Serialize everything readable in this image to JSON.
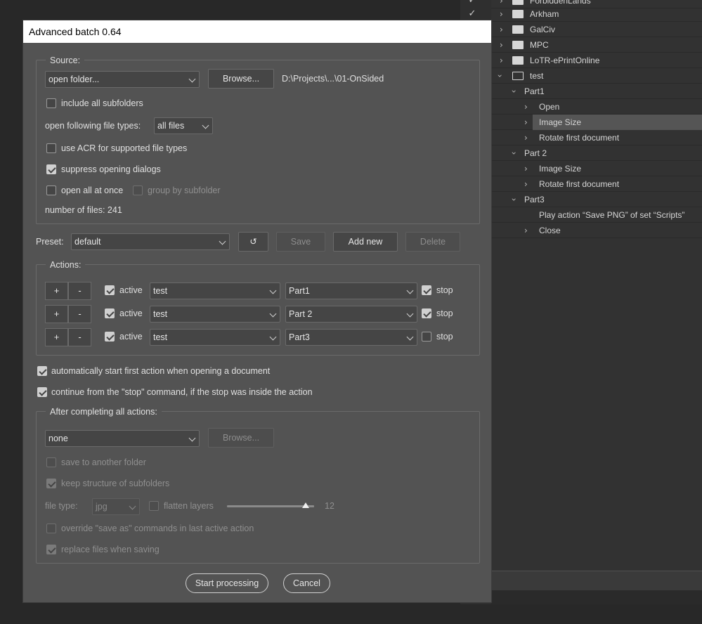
{
  "actions_panel": {
    "items": [
      {
        "label": "ForbiddenLands",
        "type": "set",
        "checked": true
      },
      {
        "label": "Arkham",
        "type": "set",
        "checked": true
      },
      {
        "label": "GalCiv",
        "type": "set"
      },
      {
        "label": "MPC",
        "type": "set"
      },
      {
        "label": "LoTR-ePrintOnline",
        "type": "set"
      },
      {
        "label": "test",
        "type": "set",
        "expanded": true
      },
      {
        "label": "Part1",
        "type": "action",
        "expanded": true
      },
      {
        "label": "Open",
        "type": "step"
      },
      {
        "label": "Image Size",
        "type": "step",
        "selected": true
      },
      {
        "label": "Rotate first document",
        "type": "step"
      },
      {
        "label": "Part 2",
        "type": "action",
        "expanded": true
      },
      {
        "label": "Image Size",
        "type": "step"
      },
      {
        "label": "Rotate first document",
        "type": "step"
      },
      {
        "label": "Part3",
        "type": "action",
        "expanded": true
      },
      {
        "label": "Play action “Save PNG” of set “Scripts”",
        "type": "step"
      },
      {
        "label": "Close",
        "type": "step"
      }
    ]
  },
  "dialog": {
    "title": "Advanced batch 0.64",
    "source": {
      "group_title": "Source:",
      "source_select": "open folder...",
      "browse_label": "Browse...",
      "path": "D:\\Projects\\...\\01-OnSided",
      "include_subfolders": "include all subfolders",
      "file_types_label": "open following file types:",
      "file_types_value": "all files",
      "use_acr": "use ACR for supported file types",
      "suppress_dialogs": "suppress opening dialogs",
      "open_all": "open all at once",
      "group_by_subfolder": "group by subfolder",
      "file_count": "number of files: 241"
    },
    "preset": {
      "label": "Preset:",
      "value": "default",
      "reset_icon": "↺",
      "save_label": "Save",
      "add_new_label": "Add new",
      "delete_label": "Delete"
    },
    "actions": {
      "group_title": "Actions:",
      "plus": "+",
      "minus": "-",
      "active_label": "active",
      "stop_label": "stop",
      "rows": [
        {
          "set": "test",
          "action": "Part1",
          "active": true,
          "stop": true
        },
        {
          "set": "test",
          "action": "Part 2",
          "active": true,
          "stop": true
        },
        {
          "set": "test",
          "action": "Part3",
          "active": true,
          "stop": false
        }
      ]
    },
    "auto_start": "automatically start first action when opening a document",
    "continue_stop": "continue from the \"stop\" command, if the stop was inside the action",
    "after": {
      "group_title": "After completing all actions:",
      "select_value": "none",
      "browse_label": "Browse...",
      "save_another": "save to another folder",
      "keep_structure": "keep structure of subfolders",
      "file_type_label": "file type:",
      "file_type_value": "jpg",
      "flatten": "flatten layers",
      "quality_value": "12",
      "quality_fraction": 0.9,
      "override_save_as": "override \"save as\" commands in last active action",
      "replace_files": "replace files when saving"
    },
    "start_label": "Start processing",
    "cancel_label": "Cancel"
  }
}
